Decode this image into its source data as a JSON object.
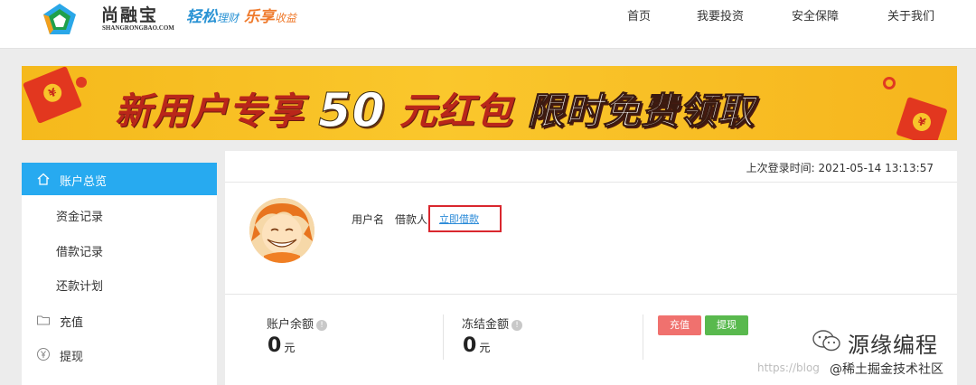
{
  "brand": {
    "name": "尚融宝",
    "domain": "SHANGRONGBAO.COM",
    "slogan_part1": "轻松",
    "slogan_part2": "理财",
    "slogan_part3": "乐享",
    "slogan_part4": "收益"
  },
  "nav": [
    "首页",
    "我要投资",
    "安全保障",
    "关于我们"
  ],
  "banner": {
    "text_before": "新用户专享",
    "amount": "50",
    "text_after": "元红包",
    "text_tail": "限时免费领取",
    "envelope_symbol": "¥"
  },
  "sidebar": {
    "items": [
      {
        "label": "账户总览",
        "icon": "home-icon",
        "active": true
      },
      {
        "label": "资金记录",
        "icon": "",
        "active": false
      },
      {
        "label": "借款记录",
        "icon": "",
        "active": false
      },
      {
        "label": "还款计划",
        "icon": "",
        "active": false
      },
      {
        "label": "充值",
        "icon": "folder-icon",
        "active": false
      },
      {
        "label": "提现",
        "icon": "yen-circle-icon",
        "active": false
      }
    ]
  },
  "account": {
    "last_login_label": "上次登录时间:",
    "last_login_time": "2021-05-14 13:13:57",
    "username_label": "用户名",
    "username_value": "借款人",
    "borrow_link": "立即借款"
  },
  "stats": {
    "balance_label": "账户余额",
    "balance_value": "0",
    "frozen_label": "冻结金额",
    "frozen_value": "0",
    "unit": "元",
    "recharge_button": "充值",
    "withdraw_button": "提现"
  },
  "watermark": {
    "title": "源缘编程",
    "url": "https://blog",
    "site": "@稀土掘金技术社区"
  },
  "colors": {
    "accent": "#27aaf0",
    "highlight_border": "#d9272e",
    "recharge": "#f0716e",
    "withdraw": "#59b94e",
    "banner": "#fac72c"
  }
}
